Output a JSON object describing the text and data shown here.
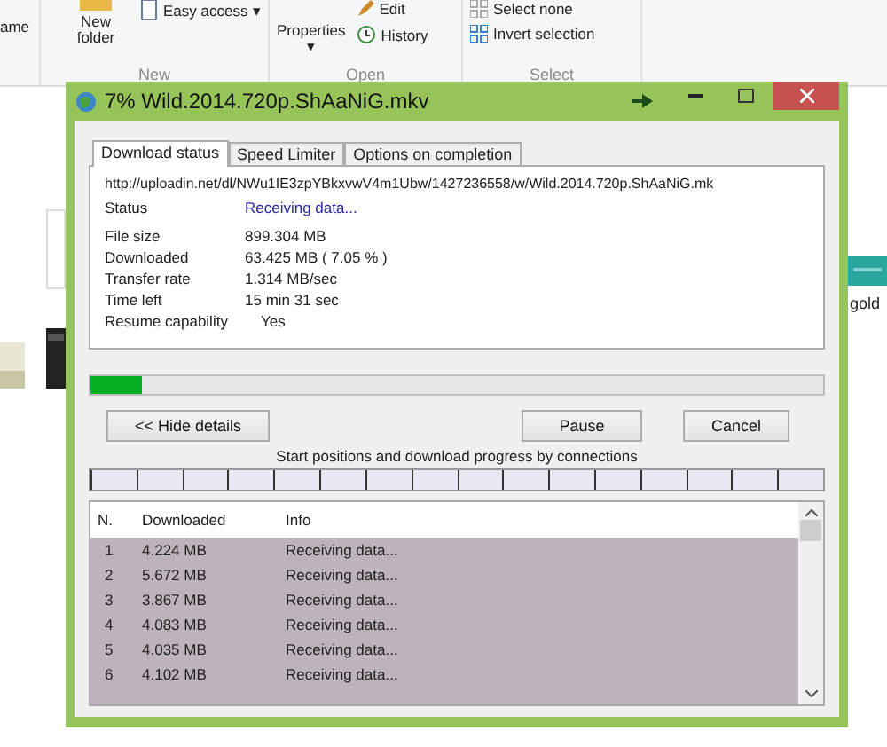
{
  "ribbon": {
    "cut_label": "ame",
    "new_folder": "New folder",
    "easy_access": "Easy access",
    "easy_access_arrow": "▾",
    "properties": "Properties",
    "properties_arrow": "▾",
    "edit": "Edit",
    "history": "History",
    "select_none": "Select none",
    "invert_selection": "Invert selection",
    "groups": [
      "New",
      "Open",
      "Select"
    ]
  },
  "file_area": {
    "cut_caption": "gold"
  },
  "dialog": {
    "title": "7% Wild.2014.720p.ShAaNiG.mkv",
    "tabs": [
      {
        "label": "Download status",
        "selected": true
      },
      {
        "label": "Speed Limiter",
        "selected": false
      },
      {
        "label": "Options on completion",
        "selected": false
      }
    ],
    "url": "http://uploadin.net/dl/NWu1IE3zpYBkxvwV4m1Ubw/1427236558/w/Wild.2014.720p.ShAaNiG.mk",
    "status": {
      "label": "Status",
      "value": "Receiving data..."
    },
    "details": [
      {
        "label": "File size",
        "value": "899.304  MB"
      },
      {
        "label": "Downloaded",
        "value": "63.425  MB  ( 7.05 % )"
      },
      {
        "label": "Transfer rate",
        "value": "1.314  MB/sec"
      },
      {
        "label": "Time left",
        "value": "15 min 31 sec"
      },
      {
        "label": "Resume capability",
        "value": "Yes"
      }
    ],
    "progress": {
      "level": 0.07
    },
    "buttons": [
      "<< Hide details",
      "Pause",
      "Cancel"
    ],
    "connections_caption": "Start positions and download progress by connections",
    "connections_list": {
      "columns": [
        "N.",
        "Downloaded",
        "Info"
      ],
      "rows": [
        {
          "n": "1",
          "downloaded": "4.224  MB",
          "info": "Receiving data..."
        },
        {
          "n": "2",
          "downloaded": "5.672  MB",
          "info": "Receiving data..."
        },
        {
          "n": "3",
          "downloaded": "3.867  MB",
          "info": "Receiving data..."
        },
        {
          "n": "4",
          "downloaded": "4.083  MB",
          "info": "Receiving data..."
        },
        {
          "n": "5",
          "downloaded": "4.035  MB",
          "info": "Receiving data..."
        },
        {
          "n": "6",
          "downloaded": "4.102  MB",
          "info": "Receiving data..."
        }
      ]
    }
  }
}
